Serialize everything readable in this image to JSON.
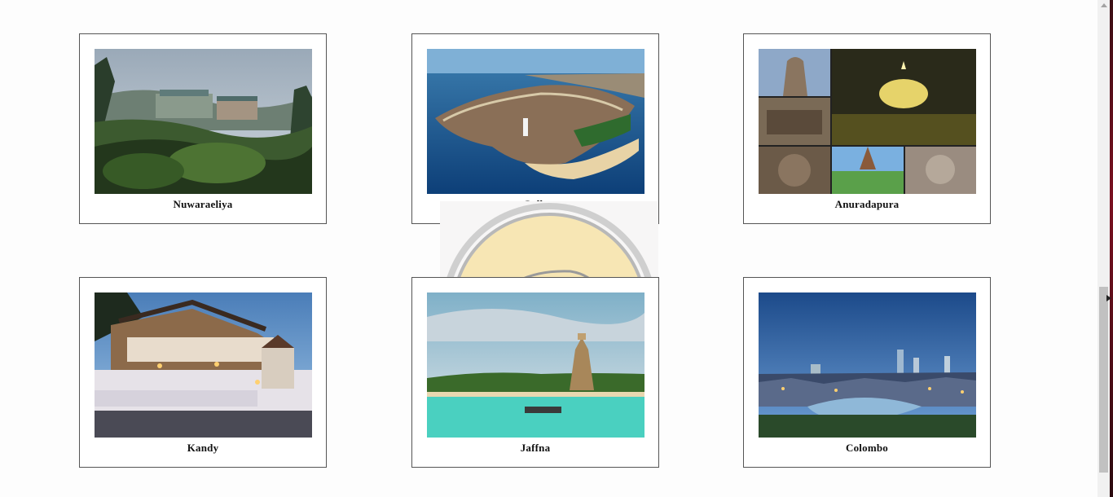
{
  "destinations": [
    {
      "name": "Nuwaraeliya",
      "image": "nuwaraeliya-hotel-photo"
    },
    {
      "name": "Galle",
      "image": "galle-fort-aerial-photo"
    },
    {
      "name": "Anuradapura",
      "image": "anuradapura-collage-photo"
    },
    {
      "name": "Kandy",
      "image": "kandy-temple-photo"
    },
    {
      "name": "Jaffna",
      "image": "jaffna-temple-coast-photo"
    },
    {
      "name": "Colombo",
      "image": "colombo-skyline-photo"
    }
  ],
  "watermark": {
    "icon": "car-logo-icon"
  },
  "colors": {
    "card_border": "#555555",
    "watermark_fill": "#f7e6b4"
  }
}
